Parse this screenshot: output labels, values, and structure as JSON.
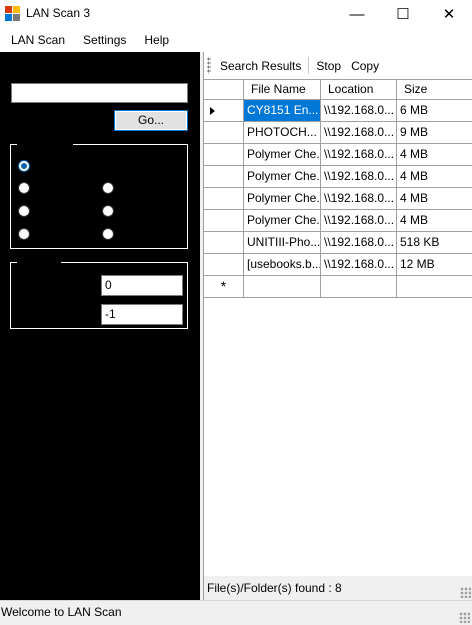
{
  "window": {
    "title": "LAN Scan 3",
    "minimize_glyph": "—",
    "maximize_glyph": "☐",
    "close_glyph": "✕"
  },
  "menu": {
    "items": [
      "LAN Scan",
      "Settings",
      "Help"
    ]
  },
  "search_panel": {
    "path_value": "",
    "go_label": "Go...",
    "options_group": {
      "radios": [
        {
          "checked": true
        },
        {
          "checked": false
        },
        {
          "checked": false
        },
        {
          "checked": false
        },
        {
          "checked": false
        },
        {
          "checked": false
        },
        {
          "checked": false
        }
      ]
    },
    "range_group": {
      "min_value": "0",
      "max_value": "-1"
    }
  },
  "toolbar": {
    "search_results_label": "Search Results",
    "stop_label": "Stop",
    "copy_label": "Copy"
  },
  "results_grid": {
    "columns": [
      "File Name",
      "Location",
      "Size"
    ],
    "rows": [
      {
        "name": "CY8151 En...",
        "location": "\\\\192.168.0...",
        "size": "6 MB"
      },
      {
        "name": "PHOTOCH...",
        "location": "\\\\192.168.0...",
        "size": "9 MB"
      },
      {
        "name": "Polymer Che...",
        "location": "\\\\192.168.0...",
        "size": "4 MB"
      },
      {
        "name": "Polymer Che...",
        "location": "\\\\192.168.0...",
        "size": "4 MB"
      },
      {
        "name": "Polymer Che...",
        "location": "\\\\192.168.0...",
        "size": "4 MB"
      },
      {
        "name": "Polymer Che...",
        "location": "\\\\192.168.0...",
        "size": "4 MB"
      },
      {
        "name": "UNITIII-Pho...",
        "location": "\\\\192.168.0...",
        "size": "518 KB"
      },
      {
        "name": "[usebooks.b...",
        "location": "\\\\192.168.0...",
        "size": "12 MB"
      }
    ],
    "new_row_marker": "*",
    "found_text": "File(s)/Folder(s) found : 8"
  },
  "status_bar": {
    "text": "Welcome to LAN Scan"
  },
  "colors": {
    "selection": "#0078d7",
    "left_panel_bg": "#000000",
    "accent_radio": "#0063b1"
  }
}
